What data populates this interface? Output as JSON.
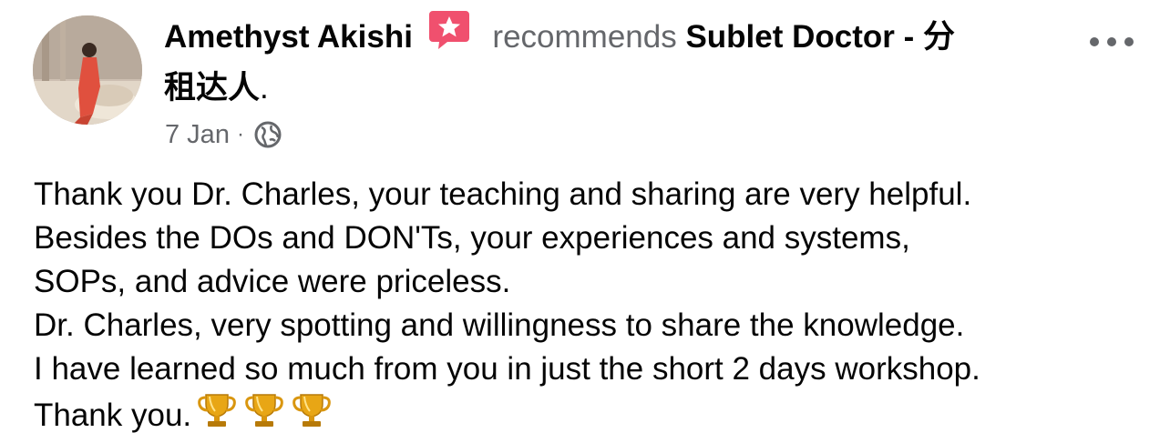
{
  "post": {
    "author": "Amethyst Akishi",
    "action": "recommends",
    "page_name_line1": "Sublet Doctor - 分",
    "page_name_line2": "租达人",
    "page_suffix": ".",
    "timestamp": "7 Jan",
    "separator": "·",
    "audience_icon": "globe-icon",
    "badge_icon": "recommend-star-icon",
    "more_icon": "more-options-icon"
  },
  "body": {
    "lines": [
      "Thank you Dr. Charles, your teaching and sharing are very helpful.",
      "Besides the DOs and DON'Ts, your experiences and systems,",
      "SOPs, and advice were priceless.",
      "Dr. Charles, very spotting and willingness to share the knowledge.",
      "I have learned so much from you in just the short 2 days workshop.",
      "Thank you."
    ],
    "emoji": "trophy-icon",
    "emoji_count": 3
  },
  "colors": {
    "text": "#050505",
    "secondary": "#65676b",
    "badge": "#f0506e"
  }
}
